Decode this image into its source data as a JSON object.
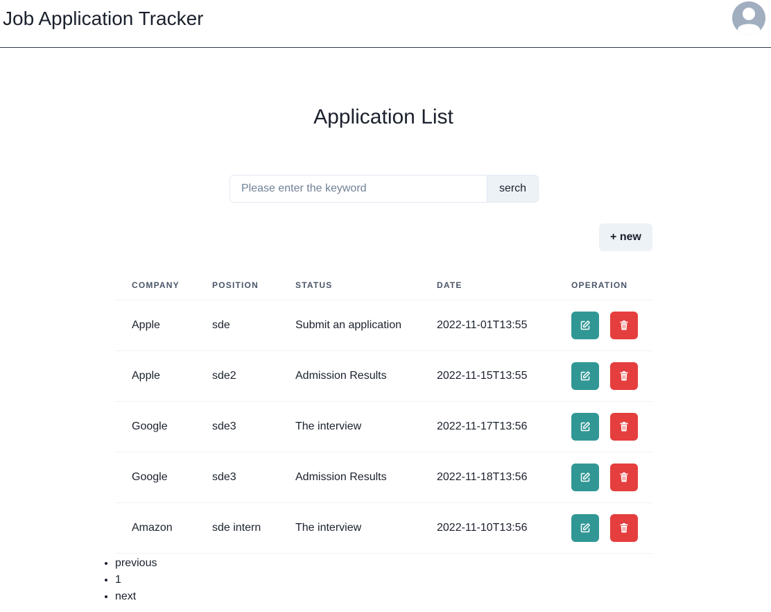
{
  "header": {
    "title": "Job Application Tracker",
    "avatar_icon": "user-avatar-icon"
  },
  "main": {
    "heading": "Application List",
    "search": {
      "placeholder": "Please enter the keyword",
      "value": "",
      "button_label": "serch"
    },
    "new_button_label": "+ new"
  },
  "table": {
    "columns": [
      "COMPANY",
      "POSITION",
      "STATUS",
      "DATE",
      "OPERATION"
    ],
    "rows": [
      {
        "company": "Apple",
        "position": "sde",
        "status": "Submit an application",
        "date": "2022-11-01T13:55"
      },
      {
        "company": "Apple",
        "position": "sde2",
        "status": "Admission Results",
        "date": "2022-11-15T13:55"
      },
      {
        "company": "Google",
        "position": "sde3",
        "status": "The interview",
        "date": "2022-11-17T13:56"
      },
      {
        "company": "Google",
        "position": "sde3",
        "status": "Admission Results",
        "date": "2022-11-18T13:56"
      },
      {
        "company": "Amazon",
        "position": "sde intern",
        "status": "The interview",
        "date": "2022-11-10T13:56"
      }
    ],
    "edit_icon": "edit-icon",
    "delete_icon": "trash-icon"
  },
  "pagination": {
    "items": [
      "previous",
      "1",
      "next"
    ]
  },
  "colors": {
    "edit_button": "#319795",
    "delete_button": "#e53e3e",
    "neutral_button": "#edf2f7"
  }
}
